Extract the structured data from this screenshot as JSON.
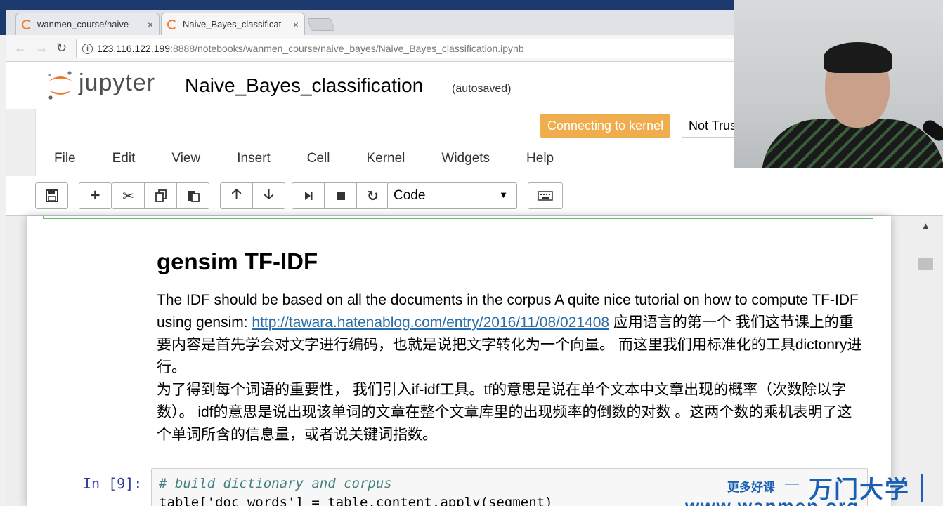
{
  "browser": {
    "tabs": [
      {
        "title": "wanmen_course/naive",
        "close": "×"
      },
      {
        "title": "Naive_Bayes_classificat",
        "close": "×"
      }
    ],
    "url_host": "123.116.122.199",
    "url_path": ":8888/notebooks/wanmen_course/naive_bayes/Naive_Bayes_classification.ipynb"
  },
  "jupyter": {
    "logo_text": "jupyter",
    "notebook_title": "Naive_Bayes_classification",
    "autosave_status": "(autosaved)",
    "kernel_status": "Connecting to kernel",
    "trust_status": "Not Trus",
    "menu": [
      "File",
      "Edit",
      "View",
      "Insert",
      "Cell",
      "Kernel",
      "Widgets",
      "Help"
    ],
    "cell_type": "Code"
  },
  "notebook": {
    "heading": "gensim TF-IDF",
    "para1_before_link": "The IDF should be based on all the documents in the corpus A quite nice tutorial on how to compute TF-IDF using gensim: ",
    "link": "http://tawara.hatenablog.com/entry/2016/11/08/021408",
    "para1_after_link": " 应用语言的第一个 我们这节课上的重要内容是首先学会对文字进行编码，也就是说把文字转化为一个向量。 而这里我们用标准化的工具dictonry进行。",
    "para2": "为了得到每个词语的重要性， 我们引入if-idf工具。tf的意思是说在单个文本中文章出现的概率（次数除以字数）。 idf的意思是说出现该单词的文章在整个文章库里的出现频率的倒数的对数 。这两个数的乘机表明了这个单词所含的信息量，或者说关键词指数。",
    "prompt": "In  [9]:",
    "code_comment": "# build dictionary and corpus",
    "code_line2": "table['doc_words'] = table.content.apply(segment)"
  },
  "watermark": {
    "more": "更多好课",
    "dash": "—",
    "brand": "万门大学",
    "url": "www.wanmen.org"
  },
  "icons": {
    "save": "save-icon",
    "add": "plus-icon",
    "cut": "scissors-icon",
    "copy": "copy-icon",
    "paste": "paste-icon",
    "up": "arrow-up-icon",
    "down": "arrow-down-icon",
    "run": "step-forward-icon",
    "stop": "stop-icon",
    "restart": "restart-icon",
    "keyboard": "keyboard-icon"
  },
  "colors": {
    "kernel_status": "#f0ad4e",
    "link": "#296eaa",
    "prompt": "#303f9f",
    "watermark": "#1a5fb4"
  }
}
